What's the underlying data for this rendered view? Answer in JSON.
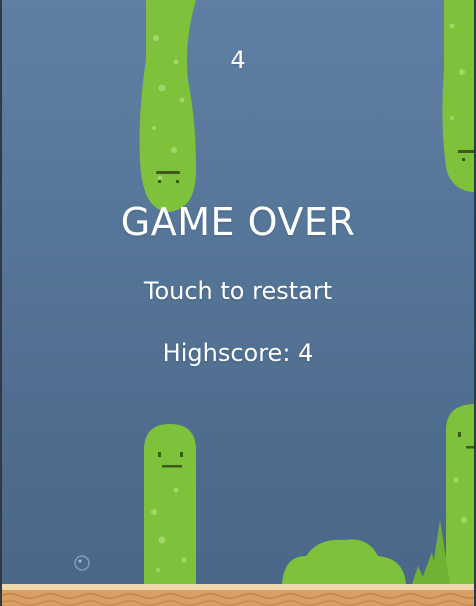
{
  "hud": {
    "score": "4",
    "game_over": "GAME OVER",
    "restart_prompt": "Touch to restart",
    "highscore": "Highscore: 4"
  },
  "colors": {
    "sky_top": "#5f7fa4",
    "sky_bottom": "#4a6688",
    "cactus_green": "#7dc23a",
    "cactus_spot": "#a3d66a",
    "cactus_face": "#3c5a1e",
    "sand": "#d9a066",
    "sand_light": "#eed6ad"
  },
  "icons": {
    "obstacle": "cactus-worm",
    "bubble": "bubble-icon",
    "bush": "bush"
  }
}
